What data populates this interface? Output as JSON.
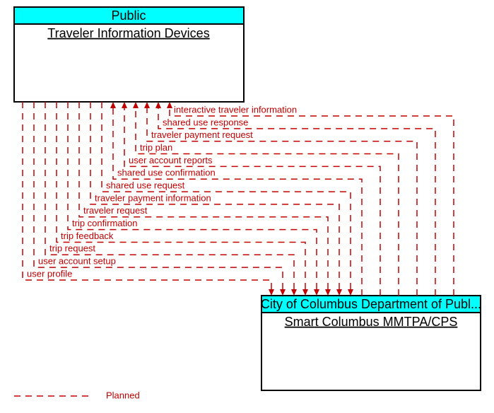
{
  "top_box": {
    "header": "Public",
    "body": "Traveler Information Devices"
  },
  "bottom_box": {
    "header": "City of Columbus Department of Publ...",
    "body": "Smart Columbus MMTPA/CPS"
  },
  "flows_down": [
    "user profile",
    "user account setup",
    "trip request",
    "trip feedback",
    "trip confirmation",
    "traveler request",
    "traveler payment information",
    "shared use request"
  ],
  "flows_up": [
    "shared use confirmation",
    "user account reports",
    "trip plan",
    "traveler payment request",
    "shared use response",
    "interactive traveler information"
  ],
  "legend": {
    "label": "Planned"
  },
  "colors": {
    "header_fill": "#00ffff",
    "line": "#c00000"
  },
  "chart_data": {
    "type": "diagram",
    "nodes": [
      {
        "id": "traveler_info_devices",
        "owner": "Public",
        "name": "Traveler Information Devices"
      },
      {
        "id": "smart_columbus",
        "owner": "City of Columbus Department of Publ...",
        "name": "Smart Columbus MMTPA/CPS"
      }
    ],
    "edges": [
      {
        "from": "traveler_info_devices",
        "to": "smart_columbus",
        "label": "user profile",
        "status": "Planned"
      },
      {
        "from": "traveler_info_devices",
        "to": "smart_columbus",
        "label": "user account setup",
        "status": "Planned"
      },
      {
        "from": "traveler_info_devices",
        "to": "smart_columbus",
        "label": "trip request",
        "status": "Planned"
      },
      {
        "from": "traveler_info_devices",
        "to": "smart_columbus",
        "label": "trip feedback",
        "status": "Planned"
      },
      {
        "from": "traveler_info_devices",
        "to": "smart_columbus",
        "label": "trip confirmation",
        "status": "Planned"
      },
      {
        "from": "traveler_info_devices",
        "to": "smart_columbus",
        "label": "traveler request",
        "status": "Planned"
      },
      {
        "from": "traveler_info_devices",
        "to": "smart_columbus",
        "label": "traveler payment information",
        "status": "Planned"
      },
      {
        "from": "traveler_info_devices",
        "to": "smart_columbus",
        "label": "shared use request",
        "status": "Planned"
      },
      {
        "from": "smart_columbus",
        "to": "traveler_info_devices",
        "label": "shared use confirmation",
        "status": "Planned"
      },
      {
        "from": "smart_columbus",
        "to": "traveler_info_devices",
        "label": "user account reports",
        "status": "Planned"
      },
      {
        "from": "smart_columbus",
        "to": "traveler_info_devices",
        "label": "trip plan",
        "status": "Planned"
      },
      {
        "from": "smart_columbus",
        "to": "traveler_info_devices",
        "label": "traveler payment request",
        "status": "Planned"
      },
      {
        "from": "smart_columbus",
        "to": "traveler_info_devices",
        "label": "shared use response",
        "status": "Planned"
      },
      {
        "from": "smart_columbus",
        "to": "traveler_info_devices",
        "label": "interactive traveler information",
        "status": "Planned"
      }
    ]
  }
}
